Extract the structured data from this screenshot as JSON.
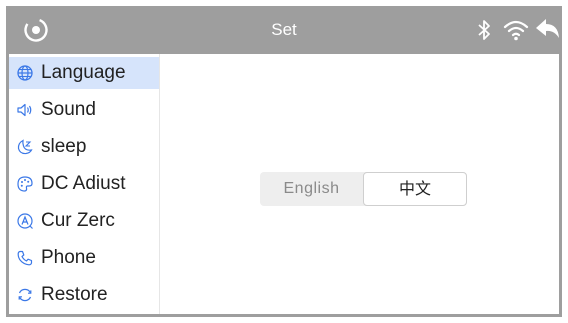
{
  "header": {
    "title": "Set",
    "icons": [
      "target-logo-icon",
      "bluetooth-icon",
      "wifi-icon",
      "back-icon"
    ]
  },
  "sidebar": {
    "items": [
      {
        "label": "Language",
        "icon": "globe-icon",
        "active": true
      },
      {
        "label": "Sound",
        "icon": "speaker-icon"
      },
      {
        "label": "sleep",
        "icon": "sleep-icon"
      },
      {
        "label": "DC Adiust",
        "icon": "palette-icon"
      },
      {
        "label": "Cur Zerc",
        "icon": "letter-a-icon"
      },
      {
        "label": "Phone",
        "icon": "phone-icon"
      },
      {
        "label": "Restore",
        "icon": "restore-icon"
      }
    ]
  },
  "language": {
    "options": [
      "English",
      "中文"
    ],
    "selected": "中文"
  },
  "colors": {
    "titlebar": "#9e9e9e",
    "active_item": "#d6e4fb",
    "icon_blue": "#3b78e7"
  }
}
